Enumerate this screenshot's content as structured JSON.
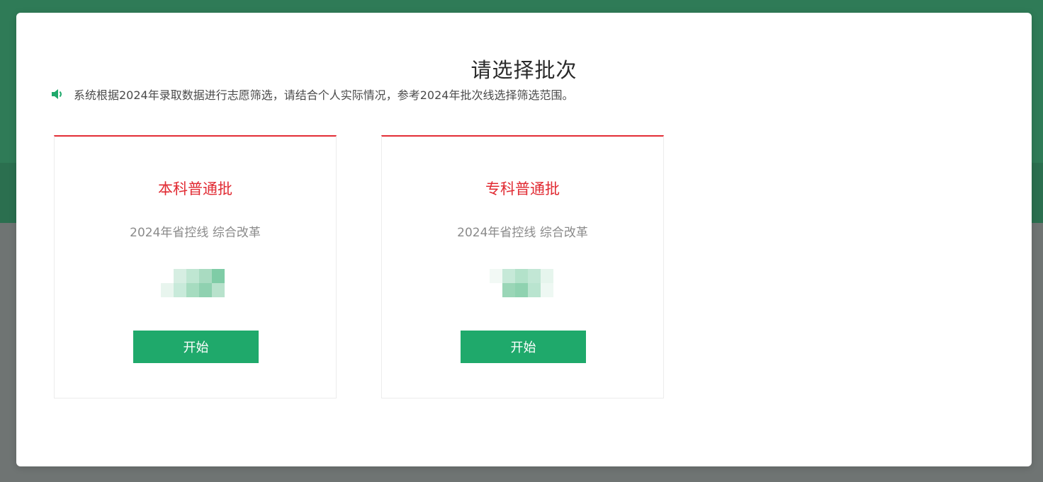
{
  "modal": {
    "title": "请选择批次",
    "notice": "系统根据2024年录取数据进行志愿筛选，请结合个人实际情况，参考2024年批次线选择筛选范围。"
  },
  "batches": [
    {
      "title": "本科普通批",
      "subtitle": "2024年省控线 综合改革",
      "button_label": "开始"
    },
    {
      "title": "专科普通批",
      "subtitle": "2024年省控线 综合改革",
      "button_label": "开始"
    }
  ],
  "colors": {
    "accent_green": "#1fa96b",
    "accent_red": "#e12b33",
    "backdrop_green": "#2f7b57"
  },
  "icons": {
    "notice": "speaker-icon"
  }
}
